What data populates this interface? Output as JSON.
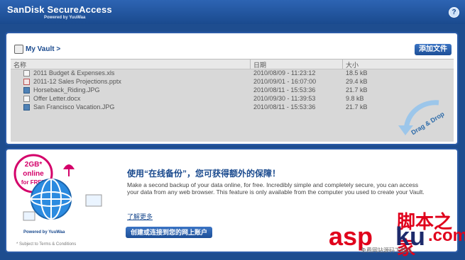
{
  "app": {
    "brand": "SanDisk SecureAccess",
    "tm": "™",
    "powered": "Powered by YuuWaa",
    "help": "?"
  },
  "vault": {
    "breadcrumb": "My Vault >",
    "add_button": "添加文件",
    "columns": [
      "名称",
      "日期",
      "大小"
    ],
    "files": [
      {
        "name": "2011 Budget & Expenses.xls",
        "date": "2010/08/09 - 11:23:12",
        "size": "18.5 kB",
        "icon": "spreadsheet-icon"
      },
      {
        "name": "2011-12 Sales Projections.pptx",
        "date": "2010/09/01 - 16:07:00",
        "size": "29.4 kB",
        "icon": "presentation-icon"
      },
      {
        "name": "Horseback_Riding.JPG",
        "date": "2010/08/11 - 15:53:36",
        "size": "21.7 kB",
        "icon": "image-icon"
      },
      {
        "name": "Offer Letter.docx",
        "date": "2010/09/30 - 11:39:53",
        "size": "9.8 kB",
        "icon": "document-icon"
      },
      {
        "name": "San Francisco Vacation.JPG",
        "date": "2010/08/11 - 15:53:36",
        "size": "21.7 kB",
        "icon": "image-icon"
      }
    ],
    "drag_drop": "Drag & Drop"
  },
  "promo": {
    "badge_line1": "2GB*",
    "badge_line2": "online",
    "badge_line3": "for FREE",
    "heading": "使用“在线备份”，您可获得额外的保障！",
    "text": "Make a second backup of your data online, for free. Incredibly simple and completely secure, you can access your data from any web browser. This feature is only available from the computer you used to create your Vault.",
    "learn_more": "了解更多",
    "connect_button": "创建或连接到您的网上账户",
    "powered": "Powered by YuuWaa",
    "subject": "* Subject to Terms & Conditions"
  },
  "watermark": {
    "cn": "脚本之家",
    "asp": "asp",
    "ku": "ku",
    "net": ".com",
    "sub": "免费网站源码下载站"
  }
}
